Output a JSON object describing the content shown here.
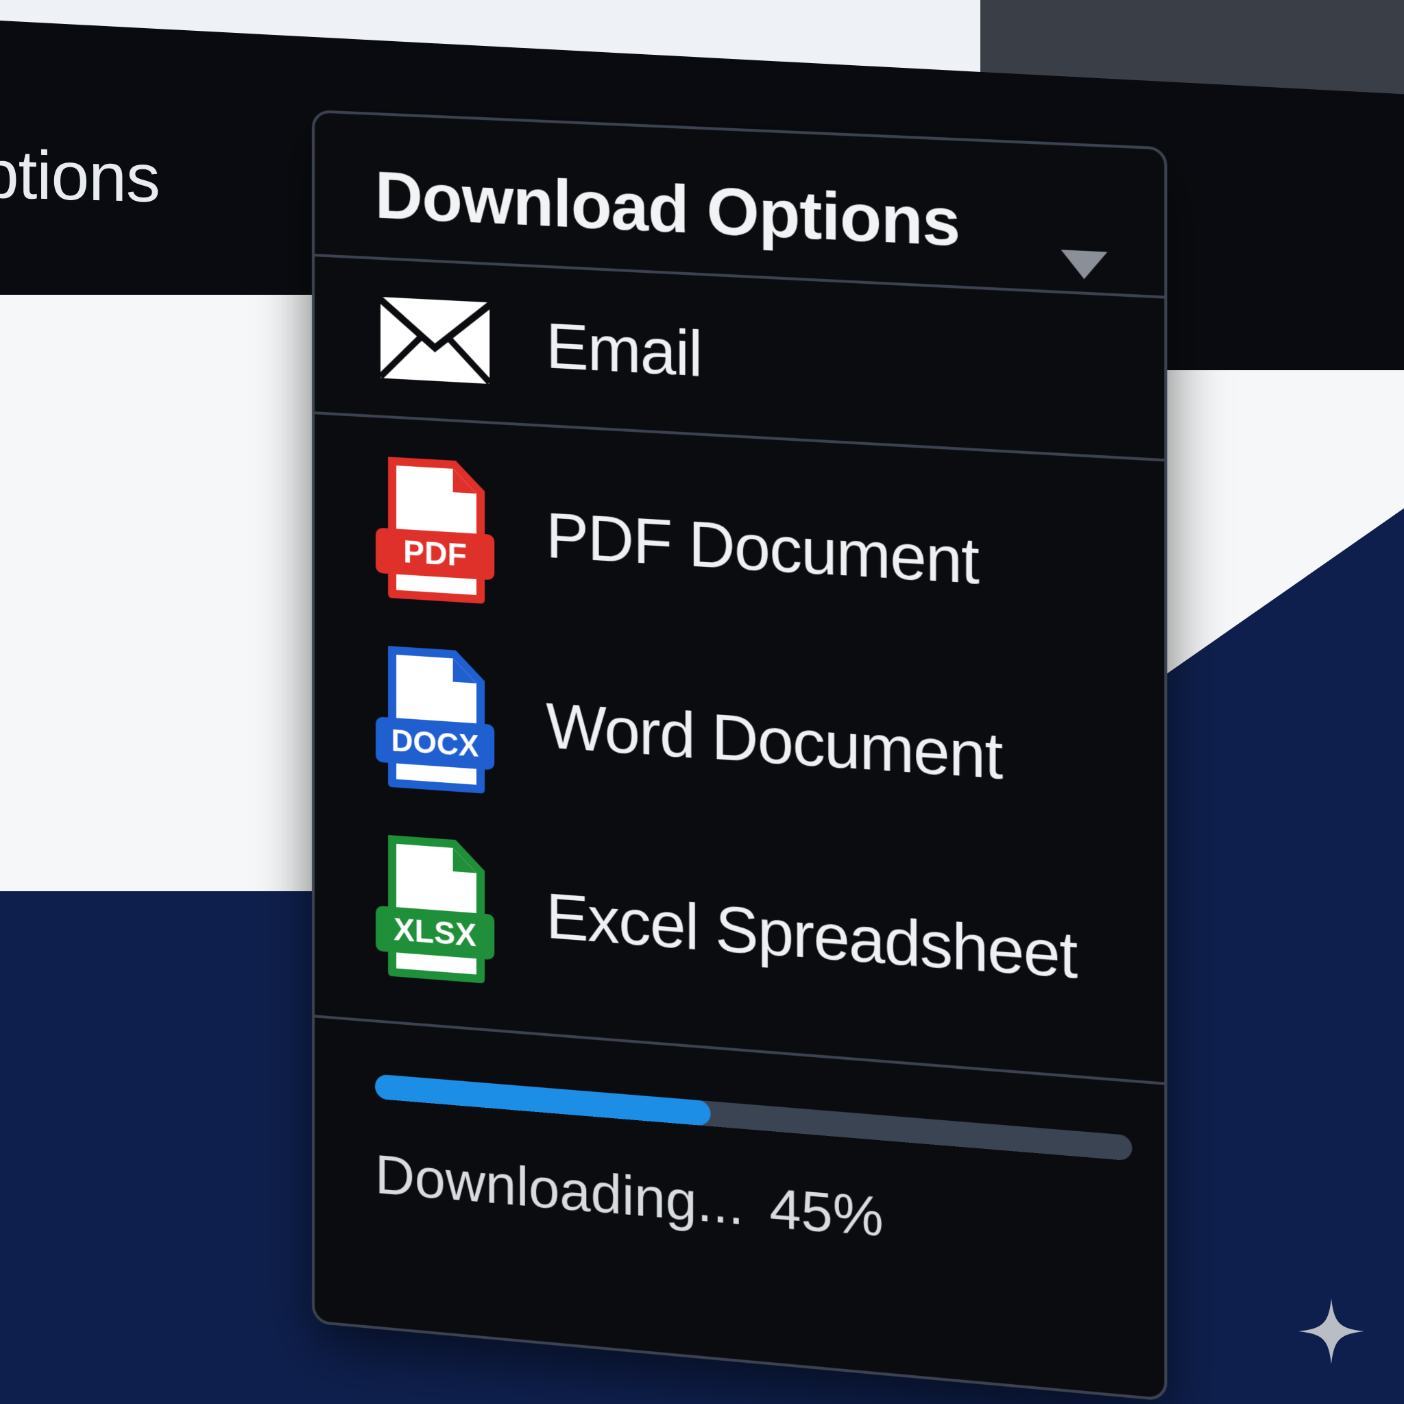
{
  "background": {
    "nav_label": "ptions"
  },
  "dropdown": {
    "title": "Download Options",
    "items": [
      {
        "label": "Email",
        "icon": "envelope-icon"
      },
      {
        "label": "PDF Document",
        "icon": "pdf-file-icon",
        "badge": "PDF",
        "color": "#e0302a"
      },
      {
        "label": "Word Document",
        "icon": "docx-file-icon",
        "badge": "DOCX",
        "color": "#1f5fd0"
      },
      {
        "label": "Excel Spreadsheet",
        "icon": "xlsx-file-icon",
        "badge": "XLSX",
        "color": "#1f8f3a"
      }
    ]
  },
  "progress": {
    "status_text": "Downloading...",
    "percent_text": "45%",
    "fraction": 0.45,
    "color": "#1d8ee6"
  },
  "colors": {
    "panel_bg": "#0b0c10",
    "border": "#3c4350",
    "text": "#eef0f2"
  }
}
